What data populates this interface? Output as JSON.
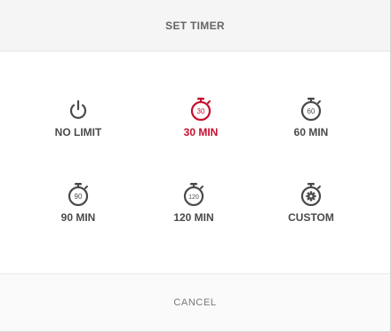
{
  "header": {
    "title": "SET TIMER"
  },
  "colors": {
    "selected": "#c8102e",
    "default": "#4a4a4a"
  },
  "options": [
    {
      "label": "NO LIMIT",
      "icon": "power-icon",
      "selected": false
    },
    {
      "label": "30 MIN",
      "icon": "stopwatch-icon",
      "icon_text": "30",
      "selected": true
    },
    {
      "label": "60 MIN",
      "icon": "stopwatch-icon",
      "icon_text": "60",
      "selected": false
    },
    {
      "label": "90 MIN",
      "icon": "stopwatch-icon",
      "icon_text": "90",
      "selected": false
    },
    {
      "label": "120 MIN",
      "icon": "stopwatch-icon",
      "icon_text": "120",
      "selected": false
    },
    {
      "label": "CUSTOM",
      "icon": "gear-stopwatch-icon",
      "selected": false
    }
  ],
  "footer": {
    "cancel_label": "CANCEL"
  }
}
